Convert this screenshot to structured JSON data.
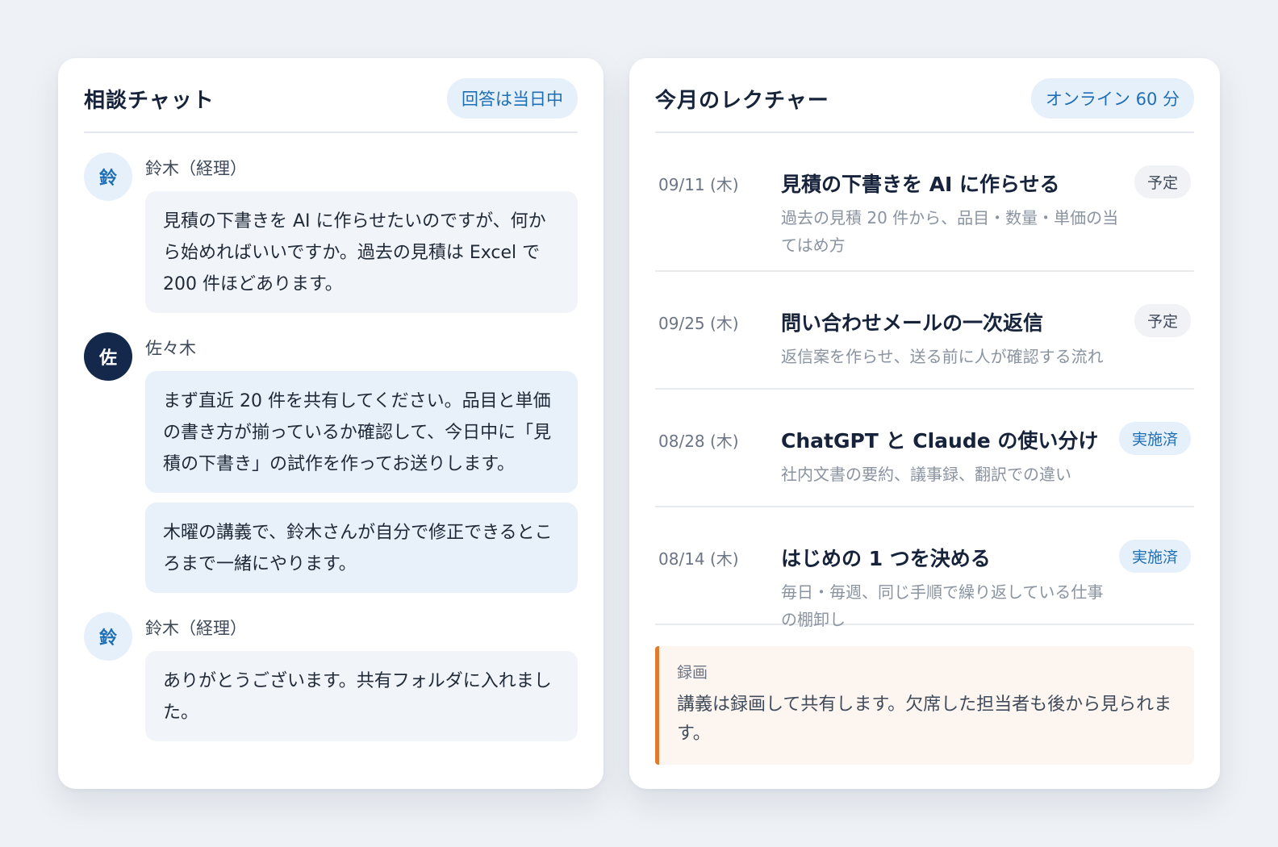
{
  "chat": {
    "title": "相談チャット",
    "badge": "回答は当日中",
    "messages": [
      {
        "avatar": "鈴",
        "sender": "鈴木（経理）",
        "bubbles": [
          "見積の下書きを AI に作らせたいのですが、何から始めればいいですか。過去の見積は Excel で 200 件ほどあります。"
        ]
      },
      {
        "avatar": "佐",
        "sender": "佐々木",
        "bubbles": [
          "まず直近 20 件を共有してください。品目と単価の書き方が揃っているか確認して、今日中に「見積の下書き」の試作を作ってお送りします。",
          "木曜の講義で、鈴木さんが自分で修正できるところまで一緒にやります。"
        ]
      },
      {
        "avatar": "鈴",
        "sender": "鈴木（経理）",
        "bubbles": [
          "ありがとうございます。共有フォルダに入れました。"
        ]
      }
    ]
  },
  "lectures": {
    "title": "今月のレクチャー",
    "badge": "オンライン 60 分",
    "items": [
      {
        "date": "09/11 (木)",
        "title": "見積の下書きを AI に作らせる",
        "desc": "過去の見積 20 件から、品目・数量・単価の当てはめ方",
        "status": "予定"
      },
      {
        "date": "09/25 (木)",
        "title": "問い合わせメールの一次返信",
        "desc": "返信案を作らせ、送る前に人が確認する流れ",
        "status": "予定"
      },
      {
        "date": "08/28 (木)",
        "title": "ChatGPT と Claude の使い分け",
        "desc": "社内文書の要約、議事録、翻訳での違い",
        "status": "実施済"
      },
      {
        "date": "08/14 (木)",
        "title": "はじめの 1 つを決める",
        "desc": "毎日・毎週、同じ手順で繰り返している仕事の棚卸し",
        "status": "実施済"
      }
    ],
    "note": {
      "label": "録画",
      "text": "講義は録画して共有します。欠席した担当者も後から見られます。"
    }
  }
}
